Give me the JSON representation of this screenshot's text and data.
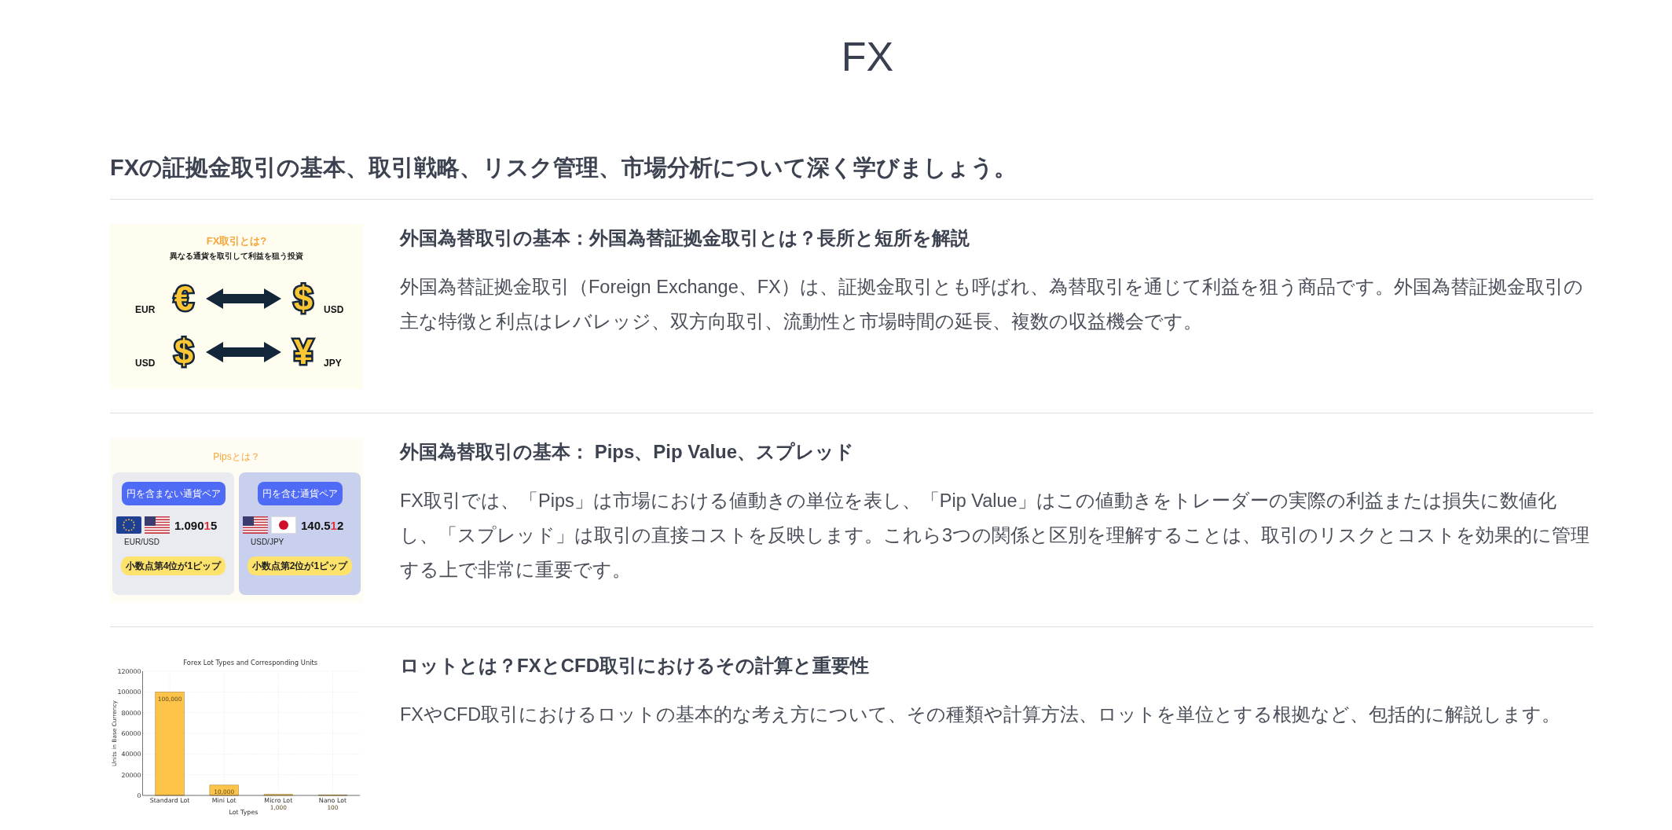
{
  "page_title": "FX",
  "intro": "FXの証拠金取引の基本、取引戦略、リスク管理、市場分析について深く学びましょう。",
  "articles": [
    {
      "title": "外国為替取引の基本：外国為替証拠金取引とは？長所と短所を解説",
      "summary": "外国為替証拠金取引（Foreign Exchange、FX）は、証拠金取引とも呼ばれ、為替取引を通じて利益を狙う商品です。外国為替証拠金取引の主な特徴と利点はレバレッジ、双方向取引、流動性と市場時間の延長、複数の収益機会です。",
      "thumbnail": {
        "kind": "currency-pairs",
        "title": "FX取引とは?",
        "subtitle": "異なる通貨を取引して利益を狙う投資",
        "pairs": [
          {
            "from": "EUR",
            "from_symbol": "€",
            "to": "USD",
            "to_symbol": "$"
          },
          {
            "from": "USD",
            "from_symbol": "$",
            "to": "JPY",
            "to_symbol": "¥"
          }
        ]
      }
    },
    {
      "title": "外国為替取引の基本： Pips、Pip Value、スプレッド",
      "summary": "FX取引では、「Pips」は市場における値動きの単位を表し、「Pip Value」はこの値動きをトレーダーの実際の利益または損失に数値化し、「スプレッド」は取引の直接コストを反映します。これら3つの関係と区別を理解することは、取引のリスクとコストを効果的に管理する上で非常に重要です。",
      "thumbnail": {
        "kind": "pips",
        "title": "Pipsとは？",
        "panels": [
          {
            "label": "円を含まない通貨ペア",
            "flags": [
              {
                "kind": "eu"
              },
              {
                "kind": "us"
              }
            ],
            "price_main": "1.090",
            "pip_digit": "1",
            "price_rest": "5",
            "pair": "EUR/USD",
            "note": "小数点第4位が1ピップ",
            "color": "#e9ebf1"
          },
          {
            "label": "円を含む通貨ペア",
            "flags": [
              {
                "kind": "us"
              },
              {
                "kind": "jp"
              }
            ],
            "price_main": "140.5",
            "pip_digit": "1",
            "price_rest": "2",
            "pair": "USD/JPY",
            "note": "小数点第2位が1ピップ",
            "color": "#c9d0ee"
          }
        ]
      }
    },
    {
      "title": "ロットとは？FXとCFD取引におけるその計算と重要性",
      "summary": "FXやCFD取引におけるロットの基本的な考え方について、その種類や計算方法、ロットを単位とする根拠など、包括的に解説します。",
      "thumbnail": {
        "kind": "chart",
        "chart_data": {
          "type": "bar",
          "title": "Forex Lot Types and Corresponding Units",
          "xlabel": "Lot Types",
          "ylabel": "Units in Base Currency",
          "categories": [
            "Standard Lot",
            "Mini Lot",
            "Micro Lot",
            "Nano Lot"
          ],
          "values": [
            100000,
            10000,
            1000,
            100
          ],
          "grid": true,
          "ylim": [
            0,
            120000
          ],
          "yticks": [
            0,
            20000,
            40000,
            60000,
            80000,
            100000,
            120000
          ],
          "value_labels": [
            "100,000",
            "10,000",
            "1,000",
            "100"
          ]
        }
      }
    }
  ]
}
